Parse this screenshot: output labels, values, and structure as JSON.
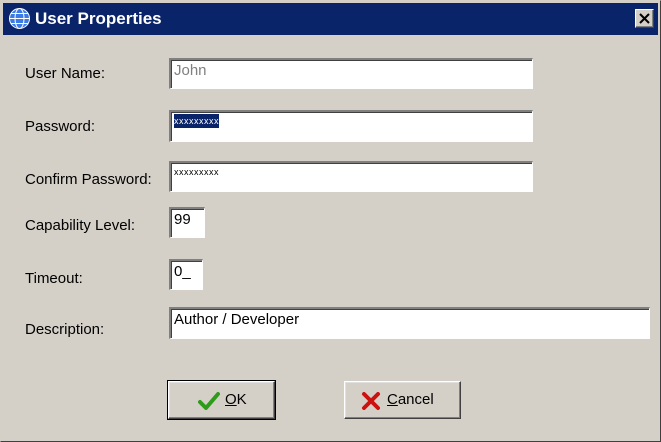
{
  "window": {
    "title": "User Properties",
    "title_icon": "globe-icon",
    "close_icon": "close-icon"
  },
  "form": {
    "user_name": {
      "label": "User Name:",
      "value": "John"
    },
    "password": {
      "label": "Password:",
      "value": "xxxxxxxxx"
    },
    "confirm_password": {
      "label": "Confirm Password:",
      "value": "xxxxxxxxx"
    },
    "capability_level": {
      "label": "Capability Level:",
      "value": "99"
    },
    "timeout": {
      "label": "Timeout:",
      "value": "0_"
    },
    "description": {
      "label": "Description:",
      "value": "Author / Developer"
    }
  },
  "buttons": {
    "ok": {
      "mnemonic": "O",
      "rest": "K",
      "icon": "checkmark-icon"
    },
    "cancel": {
      "mnemonic": "C",
      "rest": "ancel",
      "icon": "x-icon"
    }
  },
  "colors": {
    "titlebar": "#0a246a",
    "dialog_face": "#d4d0c8",
    "selection": "#0a246a",
    "ok_icon": "#2e9c1a",
    "cancel_icon": "#cc1111"
  }
}
